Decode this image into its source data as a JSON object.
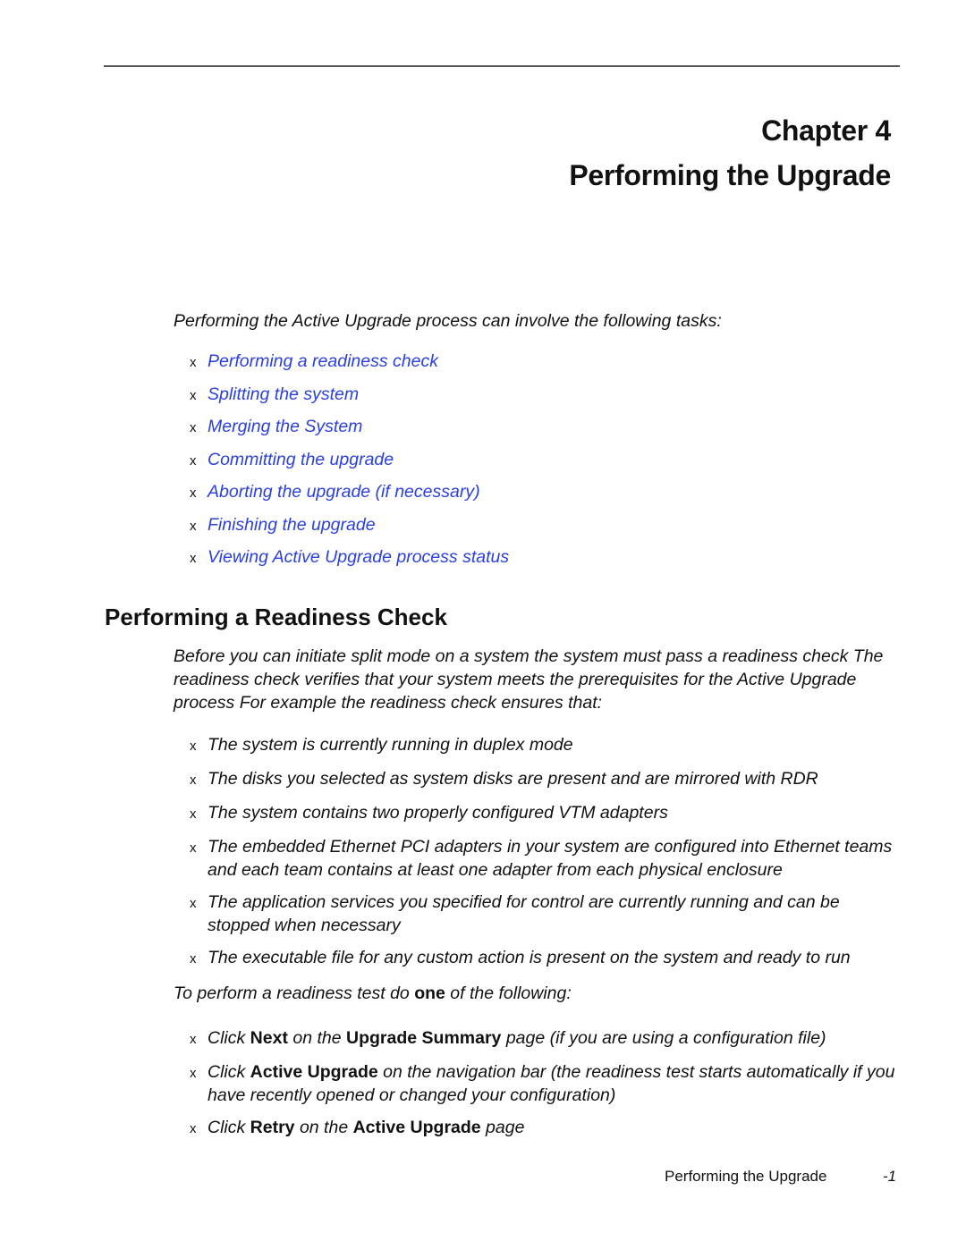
{
  "header": {
    "chapter_label": "Chapter 4",
    "chapter_title": "Performing the Upgrade"
  },
  "intro": {
    "text": "Performing the Active Upgrade process can involve the following tasks:",
    "link_color": "#2a3fe0",
    "bullet": "x",
    "tasks": [
      "Performing a readiness check",
      "Splitting the system",
      "Merging the System",
      "Committing the upgrade",
      "Aborting the upgrade (if necessary)",
      "Finishing the upgrade",
      "Viewing Active Upgrade process status"
    ]
  },
  "section": {
    "heading": "Performing a Readiness Check",
    "paragraph": "Before you can initiate split mode on a system  the system must pass a readiness check  The readiness check verifies that your system meets the prerequisites for the Active Upgrade process  For example  the readiness check ensures that:",
    "checks": [
      "The system is currently running in duplex mode",
      "The disks you selected as system disks are present and are mirrored with RDR",
      "The system contains two properly configured VTM adapters",
      "The embedded Ethernet PCI adapters in your system are configured into Ethernet teams  and each team contains at least one adapter from each physical enclosure",
      "The application services you specified for control are currently running  and can be stopped when necessary",
      "The executable file for any custom action is present on the system and ready to run"
    ],
    "lead": {
      "before": "To perform a readiness test  do ",
      "bold": "one",
      "after": " of the following:"
    },
    "actions": [
      {
        "p1": "Click ",
        "b1": "Next",
        "p2": " on the ",
        "b2": "Upgrade Summary",
        "p3": " page (if you are using a configuration file)"
      },
      {
        "p1": "Click ",
        "b1": "Active Upgrade",
        "p2": " on the navigation bar (the readiness test starts automatically if you have recently opened or changed your configuration)",
        "b2": "",
        "p3": ""
      },
      {
        "p1": "Click ",
        "b1": "Retry",
        "p2": " on the ",
        "b2": "Active Upgrade",
        "p3": " page"
      }
    ]
  },
  "footer": {
    "title": "Performing the Upgrade",
    "page": "-1"
  }
}
